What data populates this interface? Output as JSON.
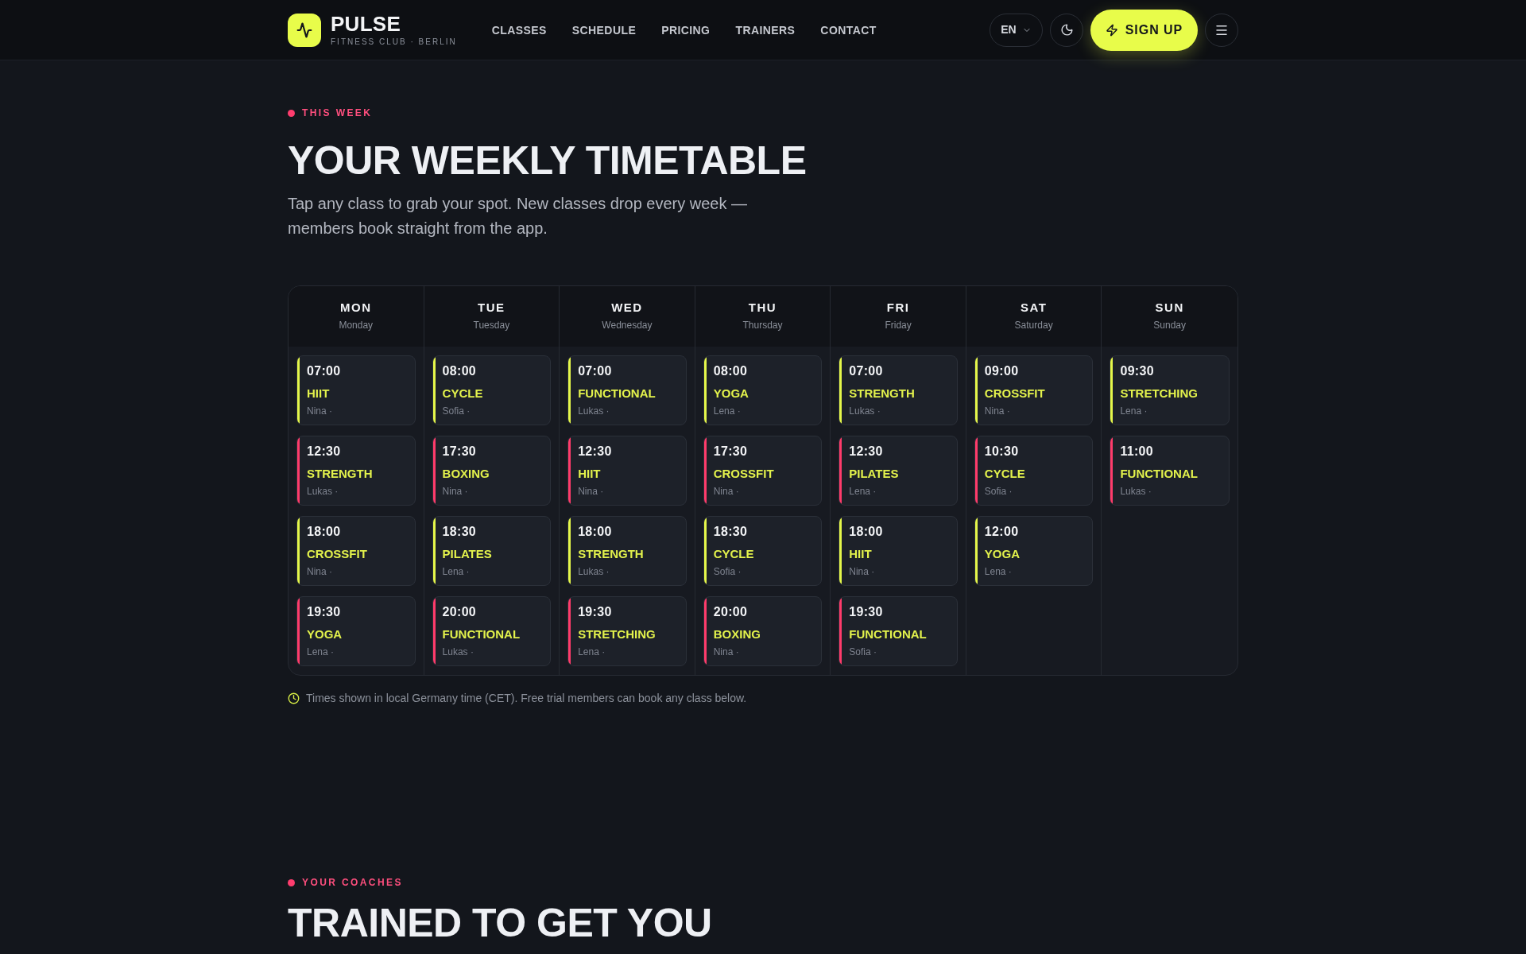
{
  "header": {
    "brand": "PULSE",
    "tagline": "FITNESS CLUB · BERLIN",
    "nav": [
      "CLASSES",
      "SCHEDULE",
      "PRICING",
      "TRAINERS",
      "CONTACT"
    ],
    "language": "EN",
    "sign_up": "SIGN UP"
  },
  "intro": {
    "eyebrow": "THIS WEEK",
    "title": "YOUR WEEKLY TIMETABLE",
    "subtitle": "Tap any class to grab your spot. New classes drop every week — members book straight from the app."
  },
  "timetable": {
    "days": [
      {
        "short": "MON",
        "long": "Monday",
        "classes": [
          {
            "time": "07:00",
            "name": "HIIT",
            "trainer": "Nina ·",
            "color": "#e5f74a"
          },
          {
            "time": "12:30",
            "name": "STRENGTH",
            "trainer": "Lukas ·",
            "color": "#ff3b6b"
          },
          {
            "time": "18:00",
            "name": "CROSSFIT",
            "trainer": "Nina ·",
            "color": "#e5f74a"
          },
          {
            "time": "19:30",
            "name": "YOGA",
            "trainer": "Lena ·",
            "color": "#ff3b6b"
          }
        ]
      },
      {
        "short": "TUE",
        "long": "Tuesday",
        "classes": [
          {
            "time": "08:00",
            "name": "CYCLE",
            "trainer": "Sofia ·",
            "color": "#e5f74a"
          },
          {
            "time": "17:30",
            "name": "BOXING",
            "trainer": "Nina ·",
            "color": "#ff3b6b"
          },
          {
            "time": "18:30",
            "name": "PILATES",
            "trainer": "Lena ·",
            "color": "#e5f74a"
          },
          {
            "time": "20:00",
            "name": "FUNCTIONAL",
            "trainer": "Lukas ·",
            "color": "#ff3b6b"
          }
        ]
      },
      {
        "short": "WED",
        "long": "Wednesday",
        "classes": [
          {
            "time": "07:00",
            "name": "FUNCTIONAL",
            "trainer": "Lukas ·",
            "color": "#e5f74a"
          },
          {
            "time": "12:30",
            "name": "HIIT",
            "trainer": "Nina ·",
            "color": "#ff3b6b"
          },
          {
            "time": "18:00",
            "name": "STRENGTH",
            "trainer": "Lukas ·",
            "color": "#e5f74a"
          },
          {
            "time": "19:30",
            "name": "STRETCHING",
            "trainer": "Lena ·",
            "color": "#ff3b6b"
          }
        ]
      },
      {
        "short": "THU",
        "long": "Thursday",
        "classes": [
          {
            "time": "08:00",
            "name": "YOGA",
            "trainer": "Lena ·",
            "color": "#e5f74a"
          },
          {
            "time": "17:30",
            "name": "CROSSFIT",
            "trainer": "Nina ·",
            "color": "#ff3b6b"
          },
          {
            "time": "18:30",
            "name": "CYCLE",
            "trainer": "Sofia ·",
            "color": "#e5f74a"
          },
          {
            "time": "20:00",
            "name": "BOXING",
            "trainer": "Nina ·",
            "color": "#ff3b6b"
          }
        ]
      },
      {
        "short": "FRI",
        "long": "Friday",
        "classes": [
          {
            "time": "07:00",
            "name": "STRENGTH",
            "trainer": "Lukas ·",
            "color": "#e5f74a"
          },
          {
            "time": "12:30",
            "name": "PILATES",
            "trainer": "Lena ·",
            "color": "#ff3b6b"
          },
          {
            "time": "18:00",
            "name": "HIIT",
            "trainer": "Nina ·",
            "color": "#e5f74a"
          },
          {
            "time": "19:30",
            "name": "FUNCTIONAL",
            "trainer": "Sofia ·",
            "color": "#ff3b6b"
          }
        ]
      },
      {
        "short": "SAT",
        "long": "Saturday",
        "classes": [
          {
            "time": "09:00",
            "name": "CROSSFIT",
            "trainer": "Nina ·",
            "color": "#e5f74a"
          },
          {
            "time": "10:30",
            "name": "CYCLE",
            "trainer": "Sofia ·",
            "color": "#ff3b6b"
          },
          {
            "time": "12:00",
            "name": "YOGA",
            "trainer": "Lena ·",
            "color": "#e5f74a"
          }
        ]
      },
      {
        "short": "SUN",
        "long": "Sunday",
        "classes": [
          {
            "time": "09:30",
            "name": "STRETCHING",
            "trainer": "Lena ·",
            "color": "#e5f74a"
          },
          {
            "time": "11:00",
            "name": "FUNCTIONAL",
            "trainer": "Lukas ·",
            "color": "#ff3b6b"
          }
        ]
      }
    ]
  },
  "note": "Times shown in local Germany time (CET). Free trial members can book any class below.",
  "coaches": {
    "eyebrow": "YOUR COACHES",
    "title": "TRAINED TO GET YOU"
  }
}
